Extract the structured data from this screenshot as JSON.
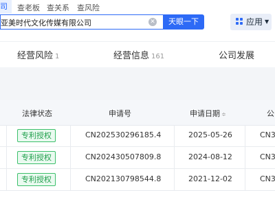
{
  "header": {
    "tabs": [
      "司",
      "查老板",
      "查关系",
      "查风险"
    ],
    "search_value": "亚美时代文化传媒有限公司",
    "search_button": "天眼一下",
    "apps_label": "应用"
  },
  "nav": {
    "items": [
      {
        "label": "经营风险",
        "count": "1"
      },
      {
        "label": "经营信息",
        "count": "161"
      },
      {
        "label": "公司发展",
        "count": ""
      }
    ]
  },
  "table": {
    "headers": [
      "法律状态",
      "申请号",
      "申请日期",
      "公"
    ],
    "rows": [
      {
        "status": "专利授权",
        "application_no": "CN202530296185.4",
        "date": "2025-05-26",
        "next": "CN3"
      },
      {
        "status": "专利授权",
        "application_no": "CN202430507809.8",
        "date": "2024-08-12",
        "next": "CN3"
      },
      {
        "status": "专利授权",
        "application_no": "CN202130798544.8",
        "date": "2021-12-02",
        "next": "CN3"
      }
    ]
  }
}
